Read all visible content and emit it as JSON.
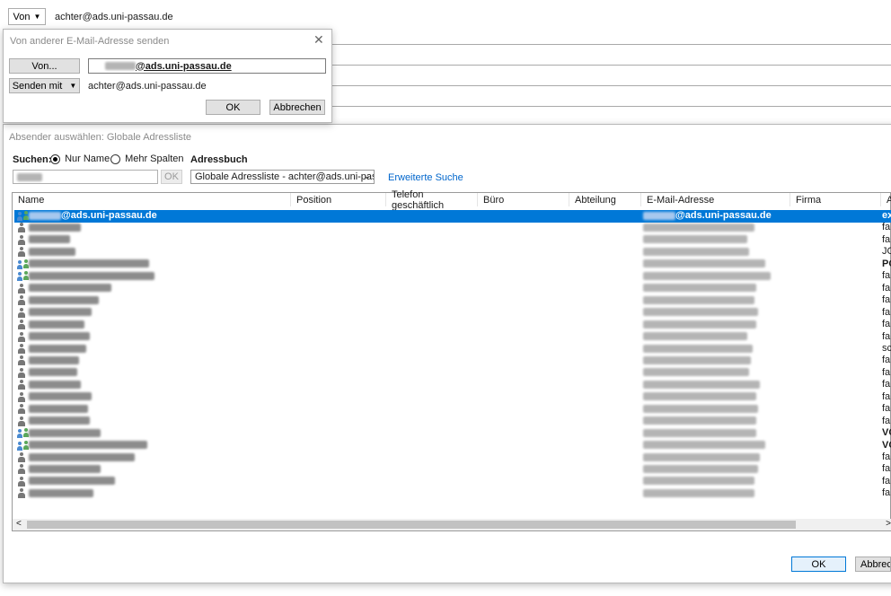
{
  "compose": {
    "from_button": "Von",
    "from_address": "achter@ads.uni-passau.de"
  },
  "send_from_dialog": {
    "title": "Von anderer E-Mail-Adresse senden",
    "von_button": "Von...",
    "from_field_suffix": "@ads.uni-passau.de",
    "senden_mit_button": "Senden mit",
    "senden_mit_value": "achter@ads.uni-passau.de",
    "ok": "OK",
    "cancel": "Abbrechen"
  },
  "address_book_dialog": {
    "title": "Absender auswählen: Globale Adressliste",
    "search_label": "Suchen:",
    "radio_name_only": "Nur Name",
    "radio_more_columns": "Mehr Spalten",
    "address_book_label": "Adressbuch",
    "search_ok": "OK",
    "address_book_value": "Globale Adressliste - achter@ads.uni-passa",
    "advanced_search": "Erweiterte Suche",
    "columns": [
      "Name",
      "Position",
      "Telefon geschäftlich",
      "Büro",
      "Abteilung",
      "E-Mail-Adresse",
      "Firma",
      "A"
    ],
    "selected_row": {
      "name_suffix": "@ads.uni-passau.de",
      "email_suffix": "@ads.uni-passau.de",
      "last": "ex"
    },
    "rows_last_col": [
      "ex",
      "fa",
      "fa",
      "JO",
      "PO",
      "fa",
      "fa",
      "fa",
      "fa",
      "fa",
      "fa",
      "sc",
      "fa",
      "fa",
      "fa",
      "fa",
      "fa",
      "fa",
      "VO",
      "VO",
      "fa",
      "fa",
      "fa",
      "fa"
    ],
    "ok": "OK",
    "cancel": "Abbrech"
  },
  "colors": {
    "selection": "#0078d7",
    "link": "#0066cc"
  }
}
